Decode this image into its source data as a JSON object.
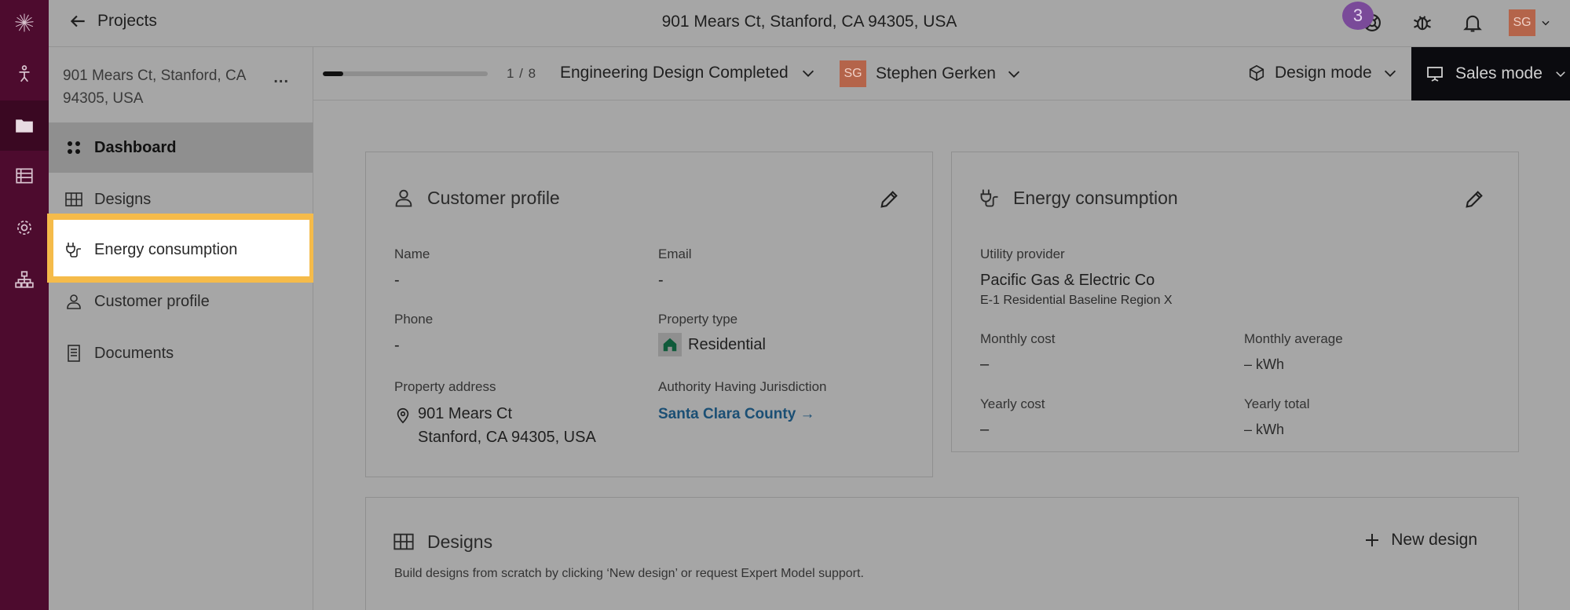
{
  "rail": {
    "items": [
      {
        "icon": "person-pin-icon"
      },
      {
        "icon": "folder-icon",
        "active": true
      },
      {
        "icon": "table-icon"
      },
      {
        "icon": "gear-icon"
      },
      {
        "icon": "org-chart-icon"
      }
    ]
  },
  "header": {
    "back_label": "Projects",
    "title": "901 Mears Ct, Stanford, CA 94305, USA",
    "notification_count": "3",
    "user_initials": "SG"
  },
  "sidebar": {
    "address": "901 Mears Ct, Stanford, CA 94305, USA",
    "more": "...",
    "items": [
      {
        "label": "Dashboard",
        "icon": "dots-grid-icon",
        "active": true
      },
      {
        "label": "Designs",
        "icon": "grid-icon"
      },
      {
        "label": "Energy consumption",
        "icon": "plug-icon",
        "highlighted": true
      },
      {
        "label": "Customer profile",
        "icon": "person-icon"
      },
      {
        "label": "Documents",
        "icon": "document-icon"
      }
    ]
  },
  "subbar": {
    "progress_fraction": 0.125,
    "progress_count": "1 / 8",
    "stage": "Engineering Design Completed",
    "assignee_initials": "SG",
    "assignee_name": "Stephen Gerken",
    "design_mode": "Design mode",
    "sales_mode": "Sales mode"
  },
  "customer_profile": {
    "title": "Customer profile",
    "name_label": "Name",
    "name_value": "-",
    "email_label": "Email",
    "email_value": "-",
    "phone_label": "Phone",
    "phone_value": "-",
    "property_type_label": "Property type",
    "property_type_value": "Residential",
    "property_address_label": "Property address",
    "address_line1": "901 Mears Ct",
    "address_line2": "Stanford, CA 94305, USA",
    "ahj_label": "Authority Having Jurisdiction",
    "ahj_value": "Santa Clara County →"
  },
  "energy_consumption": {
    "title": "Energy consumption",
    "utility_label": "Utility provider",
    "utility_value": "Pacific Gas & Electric Co",
    "rate_plan": "E-1 Residential Baseline Region X",
    "monthly_cost_label": "Monthly cost",
    "monthly_cost_value": "–",
    "monthly_avg_label": "Monthly average",
    "monthly_avg_value": "– kWh",
    "yearly_cost_label": "Yearly cost",
    "yearly_cost_value": "–",
    "yearly_total_label": "Yearly total",
    "yearly_total_value": "– kWh"
  },
  "designs": {
    "title": "Designs",
    "new_design_label": "New design",
    "description": "Build designs from scratch by clicking ‘New design’ or request Expert Model support."
  },
  "colors": {
    "rail": "#4d0b2e",
    "highlight": "#f5bb4a",
    "link": "#1b4f74",
    "notification_badge": "#7a4a99",
    "avatar": "#b4644a"
  }
}
